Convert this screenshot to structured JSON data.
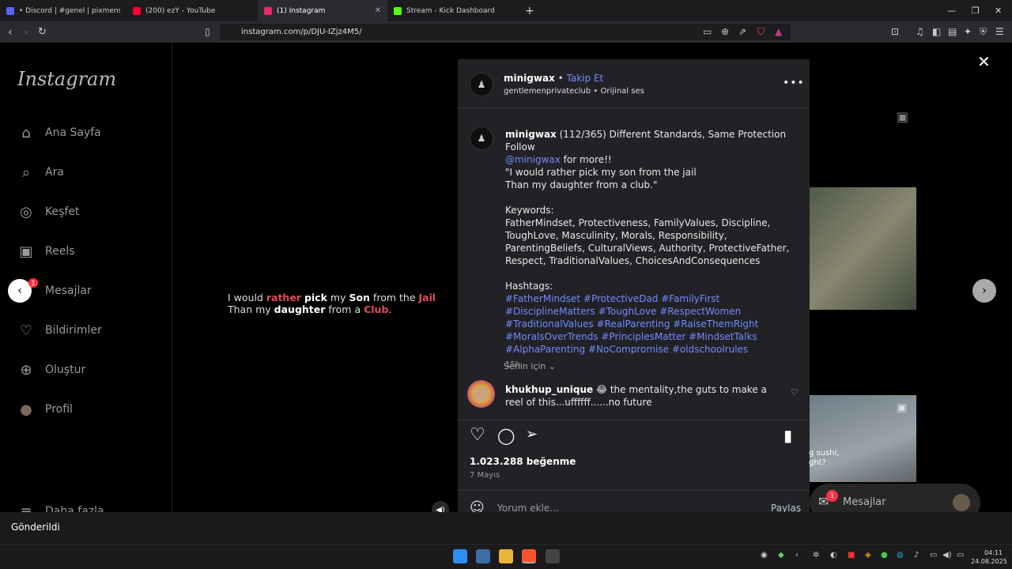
{
  "browser": {
    "tabs": [
      {
        "title": "• Discord | #genel | pixmens",
        "color": "#5865f2"
      },
      {
        "title": "(200) ezY - YouTube",
        "color": "#ff0033"
      },
      {
        "title": "(1) Instagram",
        "color": "#e1306c"
      },
      {
        "title": "Stream - Kick Dashboard",
        "color": "#53fc18"
      }
    ],
    "new_tab": "+",
    "url": "instagram.com/p/DJU-IZjz4M5/"
  },
  "sidebar": {
    "logo": "Instagram",
    "items": [
      {
        "label": "Ana Sayfa",
        "icon": "home-icon",
        "glyph": "⌂"
      },
      {
        "label": "Ara",
        "icon": "search-icon",
        "glyph": "⌕"
      },
      {
        "label": "Keşfet",
        "icon": "compass-icon",
        "glyph": "◎"
      },
      {
        "label": "Reels",
        "icon": "reels-icon",
        "glyph": "▣"
      },
      {
        "label": "Mesajlar",
        "icon": "messenger-icon",
        "glyph": "✉"
      },
      {
        "label": "Bildirimler",
        "icon": "heart-icon",
        "glyph": "♡"
      },
      {
        "label": "Oluştur",
        "icon": "plus-square-icon",
        "glyph": "⊕"
      },
      {
        "label": "Profil",
        "icon": "profile-avatar",
        "glyph": "●"
      }
    ],
    "more": "Daha fazla",
    "messages_badge": "1"
  },
  "video": {
    "line1": [
      "I would ",
      "rather",
      " ",
      "pick",
      " my ",
      "Son",
      " from the ",
      "Jail"
    ],
    "line2": [
      "Than my ",
      "daughter",
      " from a ",
      "Club",
      "."
    ]
  },
  "post": {
    "username": "minigwax",
    "follow": "Takip Et",
    "subtitle": "gentlemenprivateclub • Orijinal ses",
    "caption_user": "minigwax",
    "caption_head": " (112/365) Different Standards, Same Protection Follow",
    "mention": "@minigwax",
    "mention_tail": " for more!!",
    "quote1": "\"I would rather pick my son from the jail",
    "quote2": "Than my daughter from a club.\"",
    "keywords_title": "Keywords:",
    "keywords": "FatherMindset, Protectiveness, FamilyValues, Discipline, ToughLove, Masculinity, Morals, Responsibility, ParentingBeliefs, CulturalViews, Authority, ProtectiveFather, Respect, TraditionalValues, ChoicesAndConsequences",
    "hashtags_title": "Hashtags:",
    "hashtags": "#FatherMindset #ProtectiveDad #FamilyFirst #DisciplineMatters #ToughLove #RespectWomen #TraditionalValues #RealParenting #RaiseThemRight #MoralsOverTrends #PrinciplesMatter #MindsetTalks #AlphaParenting #NoCompromise #oldschoolrules",
    "time": "15h",
    "for_you": "Senin için",
    "comment_user": "khukhup_unique",
    "comment_text": " 😂 the mentality,the guts to make a reel of this...uffffff......no future",
    "likes": "1.023.288 beğenme",
    "date": "7 Mayıs",
    "comment_placeholder": "Yorum ekle...",
    "share": "Paylaş"
  },
  "floating": {
    "messages": "Mesajlar",
    "badge": "1",
    "thumb_text": "g sushi,\nght?"
  },
  "toast": "Gönderildi",
  "tray": {
    "time": "04:11",
    "date": "24.08.2025"
  }
}
